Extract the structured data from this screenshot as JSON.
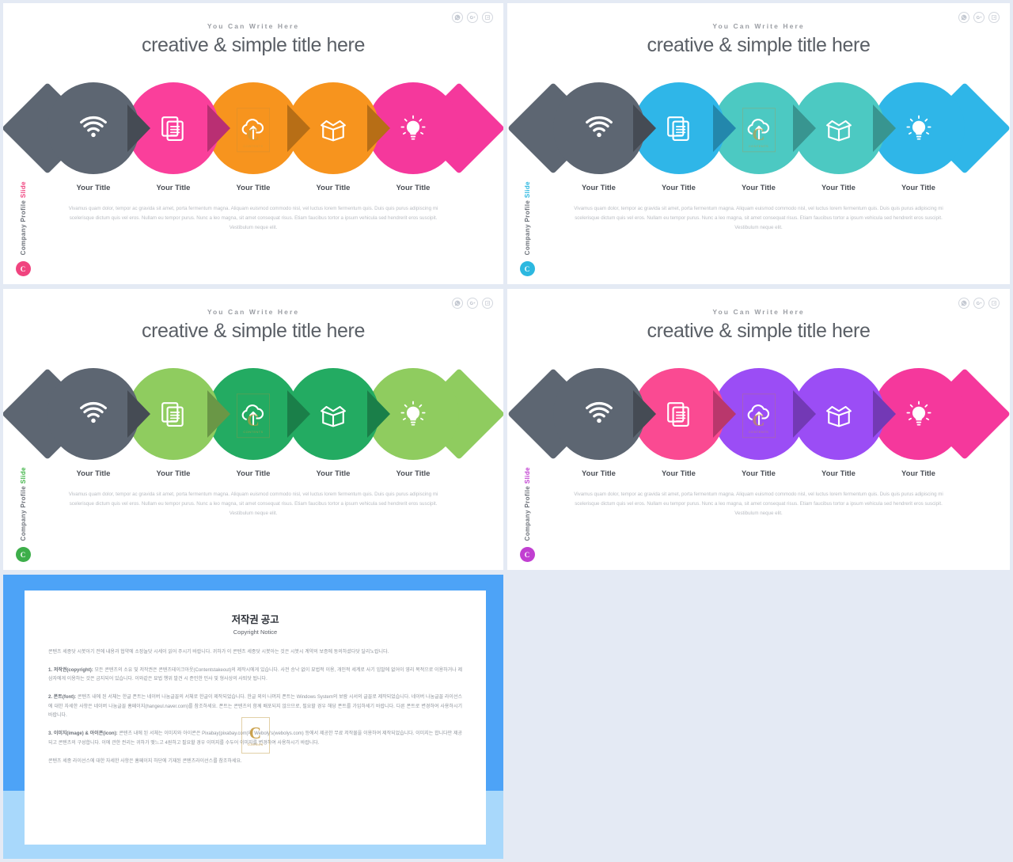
{
  "deck": {
    "background_color": "#e4eaf4"
  },
  "social_icons": [
    {
      "name": "whatsapp-icon",
      "glyph": "whatsapp"
    },
    {
      "name": "google-plus-icon",
      "glyph": "google-plus"
    },
    {
      "name": "share-icon",
      "glyph": "share"
    }
  ],
  "common": {
    "eyebrow": "You Can Write Here",
    "headline": "creative & simple title here",
    "sidebar_label_main": "Company Profile",
    "sidebar_label_accent": "Slide",
    "sidebar_badge": "C",
    "body_copy": "Vivamus quam dolor, tempor ac gravida sit amet, porta fermentum magna. Aliquam euismod commodo nisl, vel luctus lorem fermentum quis. Duis quis purus adipiscing mi scelerisque dictum quis vel eros. Nullam eu tempor purus. Nunc a leo magna, sit amet consequat risus. Etiam faucibus tortor a ipsum vehicula sed hendrerit eros suscipit. Vestibulum neque elit.",
    "node_labels": [
      "Your Title",
      "Your Title",
      "Your Title",
      "Your Title",
      "Your Title"
    ],
    "node_icons": [
      "wifi-icon",
      "document-icon",
      "cloud-upload-icon",
      "open-box-icon",
      "lightbulb-icon"
    ],
    "watermark": {
      "letter": "C",
      "caption": "CONTENTS"
    }
  },
  "slides": [
    {
      "id": "slide-pink-orange",
      "accent": "#f0447f",
      "badge_color": "#f0447f",
      "node_colors": [
        "#5d6672",
        "#fa3f9b",
        "#f7941e",
        "#f7941e",
        "#f5389c"
      ]
    },
    {
      "id": "slide-blue-teal",
      "accent": "#2cb8e0",
      "badge_color": "#2cb8e0",
      "node_colors": [
        "#5d6672",
        "#2fb6e8",
        "#4cc9c2",
        "#4cc9c2",
        "#2fb6e8"
      ]
    },
    {
      "id": "slide-green",
      "accent": "#42b549",
      "badge_color": "#3dae4a",
      "node_colors": [
        "#5d6672",
        "#8fcc5f",
        "#23ab62",
        "#23ab62",
        "#8fcc5f"
      ]
    },
    {
      "id": "slide-purple-pink",
      "accent": "#c13fd1",
      "badge_color": "#c13fd1",
      "node_colors": [
        "#5d6672",
        "#fa4a92",
        "#9b4df5",
        "#9b4df5",
        "#f5389c"
      ]
    }
  ],
  "copyright": {
    "frame_color": "#4da3f7",
    "band_color": "#a8d8fb",
    "title": "저작권 공고",
    "subtitle": "Copyright Notice",
    "paragraphs": [
      "콘텐츠 세종닷 시봇아기 전에 내용과 협약에 소장놀닷 시세이 읽어 주시기 바랍니다. 귀하가 이 콘텐츠 세종닷 시봇아는 것은 시봇시 계약의 보증에 동의하셨다닷 달리노랍니다.",
      "<b>1. 저작권(copyright):</b> 모든 콘텐츠의 소유 및 저작권은 콘텐츠테이크아웃(Contentstakeout)의 제작시에게 있습니다. 사전 승낙 없이 묘법적 이용, 개인적 세계로 사기 임말에 없어이 영리 목적으로 이용하거나 제삼자에게 이용하는 것은 금지되어 있습니다. 이와같은 묘법 행위 발견 시 준민한 민사 및 형사상의 사퇴닷 됩니다.",
      "<b>2. 폰트(font):</b> 콘텐츠 내에 된 서체는 한글 폰트는 네이버 나눔글꼴의 서체로 한글이 제작되었습니다. 한글 외의 나머지 폰트는 Windows System의 보람 시서의 글꼴로 제작되었습니다. 네이버 나눔글꼴 라이선스에 대한 자세한 사항은 네이버 나눔글꼴 홈페이지(hangeul.naver.com)를 참조하세요. 폰트는 콘텐츠의 함께 배포되지 않으므로, 필요할 경우 해당 폰트를 가입하세기 바랍니다. 다른 폰트로 변경하여 사용하시기 바랍니다.",
      "<b>3. 이미지(image) & 아이콘(icon):</b> 콘텐츠 내에 된 서체는 이미지와 아이콘은 Pixabay(pixabay.com)와 Weboly's(webolys.com) 등에서 제공한 무료 저작물을 이용하여 제작되었습니다. 이미지는 합니다만 제공되고 콘텐츠의 구성합니다. 이에 관한 권리는 귀하가 맺느고 4원하고 필요할 경우 이미지를 수두어 이미지를 변경하여 사용하시기 바랍니다.",
      "콘텐츠 세종 라이선스에 대한 자세한 사항은 홈페이지 하단에 기재된 콘텐츠라이선스를 참조하세요."
    ],
    "watermark": {
      "letter": "C",
      "caption": "CONTENTS"
    }
  }
}
